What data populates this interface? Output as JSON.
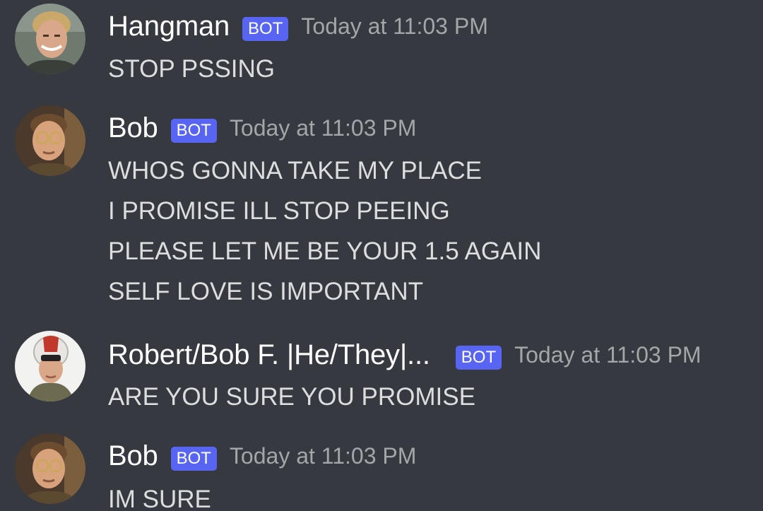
{
  "messages": [
    {
      "author": "Hangman",
      "bot_label": "BOT",
      "timestamp": "Today at 11:03 PM",
      "avatar_icon": "avatar-hangman",
      "lines": [
        "STOP PSSING"
      ]
    },
    {
      "author": "Bob",
      "bot_label": "BOT",
      "timestamp": "Today at 11:03 PM",
      "avatar_icon": "avatar-bob",
      "lines": [
        "WHOS GONNA TAKE MY PLACE",
        "I PROMISE ILL STOP PEEING",
        "PLEASE LET ME BE YOUR 1.5 AGAIN",
        "SELF LOVE IS IMPORTANT"
      ]
    },
    {
      "author": "Robert/Bob F. |He/They|...",
      "bot_label": "BOT",
      "timestamp": "Today at 11:03 PM",
      "avatar_icon": "avatar-robert-helmet",
      "lines": [
        "ARE YOU SURE YOU PROMISE"
      ]
    },
    {
      "author": "Bob",
      "bot_label": "BOT",
      "timestamp": "Today at 11:03 PM",
      "avatar_icon": "avatar-bob",
      "lines": [
        "IM SURE"
      ]
    }
  ],
  "colors": {
    "background": "#36393f",
    "username": "#ffffff",
    "bot_tag": "#5865f2",
    "timestamp": "#a3a6aa",
    "message_text": "#dcddde"
  }
}
